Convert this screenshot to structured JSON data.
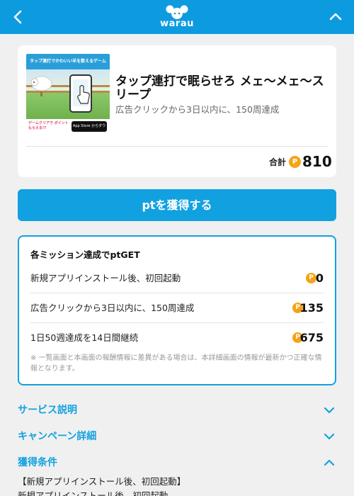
{
  "header": {
    "logo_text": "warau",
    "colors": {
      "brand": "#0d9be0"
    },
    "icons": [
      "back-chevron-icon",
      "warau-logo-icon",
      "collapse-chevron-icon"
    ]
  },
  "app": {
    "thumbnail": {
      "banner_text": "タップ連打でかわいい羊を数えるゲーム",
      "bottom_text": "ゲームクリアで ポイントもらえる!?",
      "appstore_text": "App Store からダウンロード"
    },
    "title": "タップ連打で眠らせろ メェ〜メェ〜スリープ",
    "subtitle": "広告クリックから3日以内に、150周達成",
    "total_label": "合計",
    "total_value": "810",
    "point_symbol": "P"
  },
  "get_button": {
    "label": "ptを獲得する"
  },
  "missions": {
    "heading": "各ミッション達成でptGET",
    "items": [
      {
        "label": "新規アプリインストール後、初回起動",
        "value": "0"
      },
      {
        "label": "広告クリックから3日以内に、150周達成",
        "value": "135"
      },
      {
        "label": "1日50週達成を14日間継続",
        "value": "675"
      }
    ],
    "note": "※ 一覧画面と本画面の報酬情報に差異がある場合は、本詳細画面の情報が最新かつ正確な情報となります。"
  },
  "sections": [
    {
      "label": "サービス説明",
      "expanded": false
    },
    {
      "label": "キャンペーン詳細",
      "expanded": false
    },
    {
      "label": "獲得条件",
      "expanded": true
    }
  ],
  "conditions": {
    "line1": "【新規アプリインストール後、初回起動】",
    "line2": "新規アプリインストール後、初回起動"
  },
  "colors": {
    "accent": "#12a1e0",
    "coin": "#f5a316",
    "background": "#f0f0f0"
  }
}
